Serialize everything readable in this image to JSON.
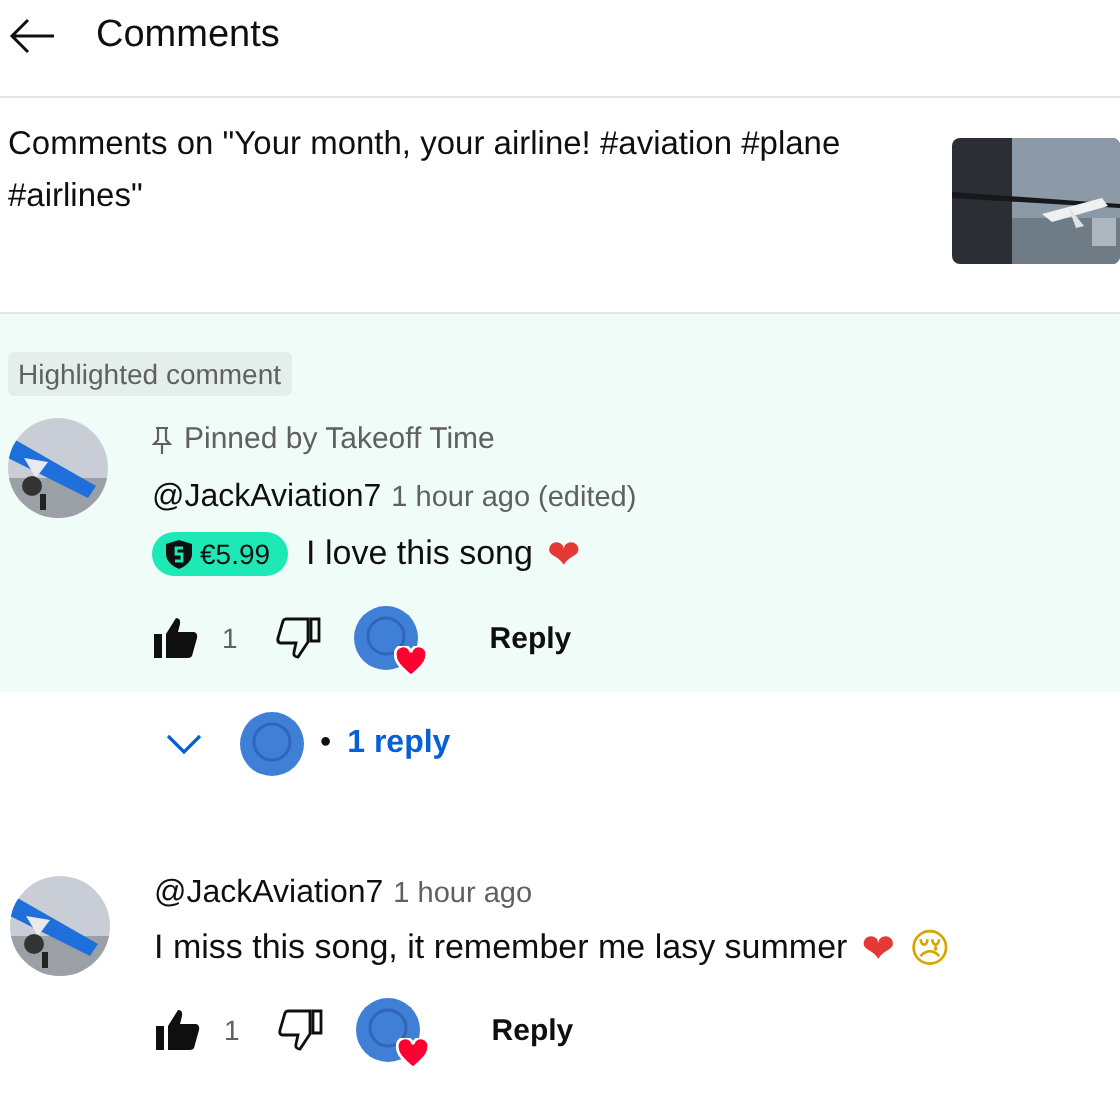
{
  "header": {
    "title": "Comments"
  },
  "video": {
    "caption": "Comments on \"Your month, your airline! #aviation #plane #airlines\""
  },
  "highlight_label": "Highlighted comment",
  "comments": [
    {
      "highlighted": true,
      "pinned": "Pinned by Takeoff Time",
      "author": "@JackAviation7",
      "time": "1 hour ago (edited)",
      "tip": "€5.99",
      "text": "I love this song",
      "emoji": [
        {
          "kind": "heart",
          "char": "❤"
        }
      ],
      "liked": true,
      "likes": "1",
      "creator_heart": true,
      "reply": "Reply",
      "replies_separator": "•",
      "replies": "1 reply"
    },
    {
      "highlighted": false,
      "author": "@JackAviation7",
      "time": "1 hour ago",
      "text": "I miss this song, it remember me lasy summer",
      "emoji": [
        {
          "kind": "heart",
          "char": "❤"
        },
        {
          "kind": "face",
          "char": "😢"
        }
      ],
      "liked": true,
      "likes": "1",
      "creator_heart": true,
      "reply": "Reply"
    }
  ]
}
